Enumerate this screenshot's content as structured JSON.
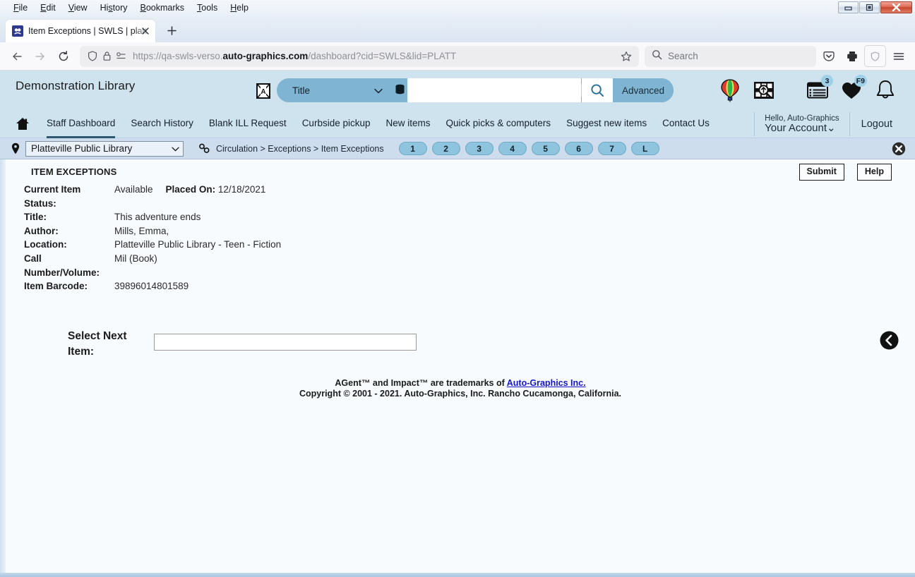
{
  "browser": {
    "menus": [
      "File",
      "Edit",
      "View",
      "History",
      "Bookmarks",
      "Tools",
      "Help"
    ],
    "tab_title": "Item Exceptions | SWLS | platt | A",
    "favicon_name": "verso-favicon",
    "newtab_label": "+",
    "url_prefix": "https://qa-swls-verso.",
    "url_domain": "auto-graphics.com",
    "url_suffix": "/dashboard?cid=SWLS&lid=PLATT",
    "search_placeholder": "Search",
    "window_controls": [
      "minimize",
      "restore",
      "close"
    ]
  },
  "app_header": {
    "library_name": "Demonstration Library",
    "translate_icon": "translate-icon",
    "search_type": "Title",
    "search_query": "",
    "database_icon": "database-icon",
    "search_icon": "magnifier-icon",
    "advanced_label": "Advanced",
    "icons": [
      {
        "name": "balloon-icon",
        "badge": ""
      },
      {
        "name": "explore-search-icon",
        "badge": ""
      },
      {
        "name": "my-lists-icon",
        "badge": "3"
      },
      {
        "name": "favorites-heart-icon",
        "badge": "F9"
      },
      {
        "name": "notifications-bell-icon",
        "badge": ""
      }
    ]
  },
  "nav": {
    "home_icon": "home-icon",
    "links": [
      "Staff Dashboard",
      "Search History",
      "Blank ILL Request",
      "Curbside pickup",
      "New items",
      "Quick picks & computers",
      "Suggest new items",
      "Contact Us"
    ],
    "active_index": 0,
    "account_hello": "Hello, Auto-Graphics",
    "account_name": "Your Account",
    "account_caret": "chevron-down-icon",
    "logout_label": "Logout"
  },
  "breadcrumb_bar": {
    "pin_icon": "location-pin-icon",
    "library_selected": "Platteville Public Library",
    "chain_icon": "link-chain-icon",
    "crumbs": "Circulation > Exceptions > Item Exceptions",
    "pills": [
      "1",
      "2",
      "3",
      "4",
      "5",
      "6",
      "7",
      "L"
    ],
    "close_icon": "close-circle-icon"
  },
  "main": {
    "section_title": "ITEM EXCEPTIONS",
    "submit_label": "Submit",
    "help_label": "Help",
    "fields": [
      {
        "label": "Current Item Status:",
        "value": "Available",
        "extra_label": "Placed On:",
        "extra_value": "12/18/2021"
      },
      {
        "label": "Title:",
        "value": "This adventure ends"
      },
      {
        "label": "Author:",
        "value": "Mills, Emma,"
      },
      {
        "label": "Location:",
        "value": "Platteville Public Library - Teen - Fiction"
      },
      {
        "label": "Call Number/Volume:",
        "value": "Mil (Book)"
      },
      {
        "label": "Item Barcode:",
        "value": "39896014801589"
      }
    ],
    "next_item_label": "Select Next Item:",
    "next_item_value": "",
    "back_icon": "back-circle-icon"
  },
  "footer": {
    "line1_pre": "AGent™ and Impact™ are trademarks of ",
    "line1_link": "Auto-Graphics Inc.",
    "line2": "Copyright © 2001 - 2021. Auto-Graphics, Inc. Rancho Cucamonga, California."
  },
  "colors": {
    "header_blue": "#cfe3ef",
    "crumb_blue": "#cddded",
    "accent_blue": "#7fb5d2",
    "pill_blue": "#8ec4de",
    "page_bg": "#f7fbfe",
    "link": "#1414cc"
  }
}
